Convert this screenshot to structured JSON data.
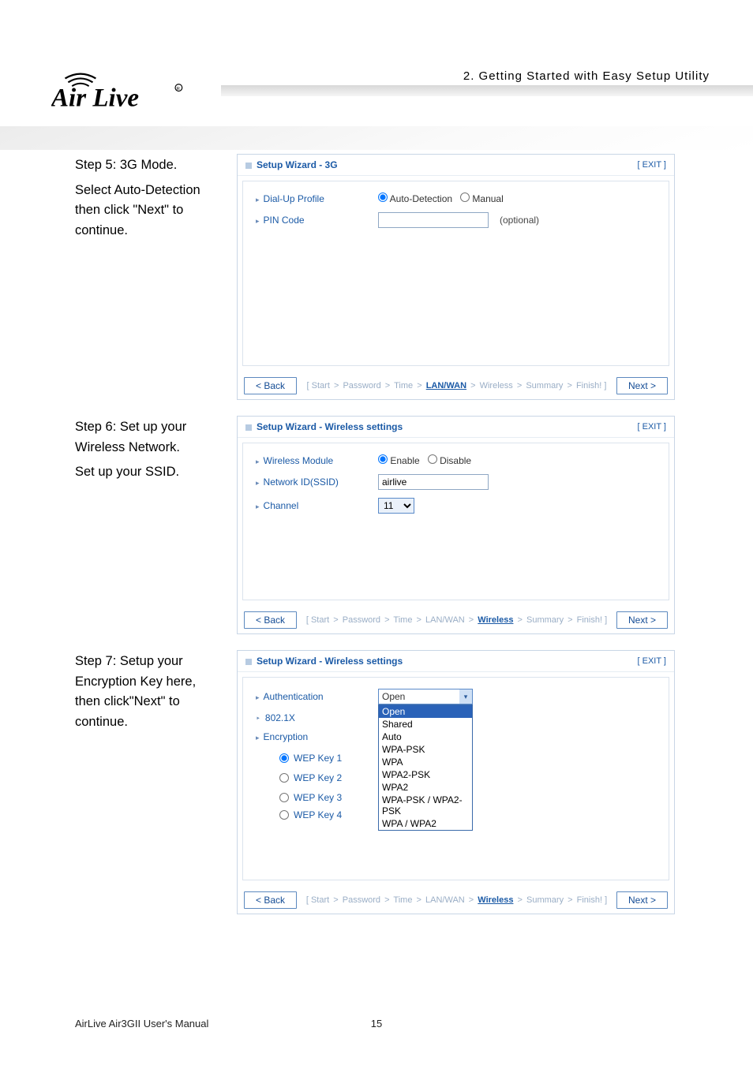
{
  "header": {
    "brand": "Air Live",
    "chapter": "2.  Getting  Started  with  Easy  Setup  Utility"
  },
  "step5": {
    "title": "Step 5: 3G Mode.",
    "desc": "Select Auto-Detection then click \"Next\" to continue.",
    "wizard": {
      "title": "Setup Wizard - 3G",
      "exit": "[ EXIT ]",
      "dialup_label": "Dial-Up Profile",
      "auto_label": "Auto-Detection",
      "manual_label": "Manual",
      "pin_label": "PIN Code",
      "pin_opt": "(optional)",
      "back": "< Back",
      "next": "Next >",
      "crumbs": [
        "Start",
        "Password",
        "Time",
        "LAN/WAN",
        "Wireless",
        "Summary",
        "Finish!"
      ],
      "current": "LAN/WAN"
    }
  },
  "step6": {
    "title": "Step 6: Set up your Wireless Network.",
    "desc": "Set up your SSID.",
    "wizard": {
      "title": "Setup Wizard - Wireless settings",
      "exit": "[ EXIT ]",
      "module_label": "Wireless Module",
      "enable": "Enable",
      "disable": "Disable",
      "ssid_label": "Network ID(SSID)",
      "ssid_value": "airlive",
      "channel_label": "Channel",
      "channel_value": "11",
      "back": "< Back",
      "next": "Next >",
      "crumbs": [
        "Start",
        "Password",
        "Time",
        "LAN/WAN",
        "Wireless",
        "Summary",
        "Finish!"
      ],
      "current": "Wireless"
    }
  },
  "step7": {
    "title": "Step 7: Setup your Encryption Key here, then click\"Next\" to continue.",
    "wizard": {
      "title": "Setup Wizard - Wireless settings",
      "exit": "[ EXIT ]",
      "auth_label": "Authentication",
      "auth_value": "Open",
      "auth_options": [
        "Open",
        "Shared",
        "Auto",
        "WPA-PSK",
        "WPA",
        "WPA2-PSK",
        "WPA2",
        "WPA-PSK / WPA2-PSK",
        "WPA / WPA2"
      ],
      "x_label": "802.1X",
      "enc_label": "Encryption",
      "wep1": "WEP Key 1",
      "wep2": "WEP Key 2",
      "wep3": "WEP Key 3",
      "wep4": "WEP Key 4",
      "back": "< Back",
      "next": "Next >",
      "crumbs": [
        "Start",
        "Password",
        "Time",
        "LAN/WAN",
        "Wireless",
        "Summary",
        "Finish!"
      ],
      "current": "Wireless"
    }
  },
  "footer": {
    "manual": "AirLive Air3GII User's Manual",
    "page": "15"
  }
}
